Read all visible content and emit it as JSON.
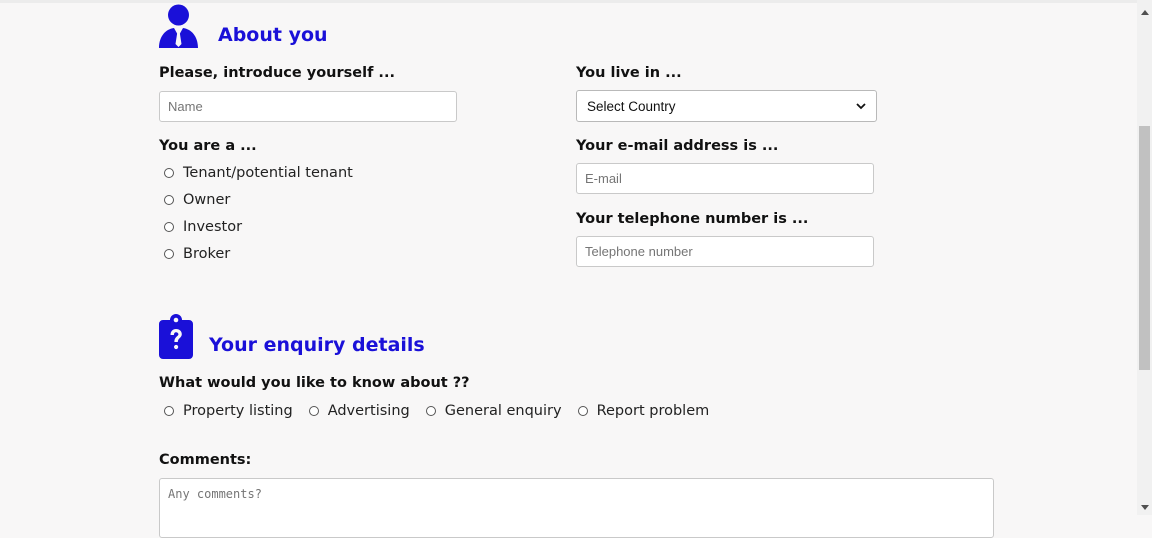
{
  "about": {
    "title": "About you",
    "icon": "user-tie-icon",
    "name_label": "Please, introduce yourself ...",
    "name_placeholder": "Name",
    "country_label": "You live in ...",
    "country_selected": "Select Country",
    "role_label": "You are a ...",
    "roles": [
      "Tenant/potential tenant",
      "Owner",
      "Investor",
      "Broker"
    ],
    "email_label": "Your e-mail address is ...",
    "email_placeholder": "E-mail",
    "phone_label": "Your telephone number is ...",
    "phone_placeholder": "Telephone number"
  },
  "enquiry": {
    "title": "Your enquiry details",
    "icon": "clipboard-question-icon",
    "topic_label": "What would you like to know about ??",
    "topics": [
      "Property listing",
      "Advertising",
      "General enquiry",
      "Report problem"
    ],
    "comments_label": "Comments:",
    "comments_placeholder": "Any comments?"
  },
  "colors": {
    "accent": "#1a10d8",
    "background": "#f8f7f7"
  }
}
